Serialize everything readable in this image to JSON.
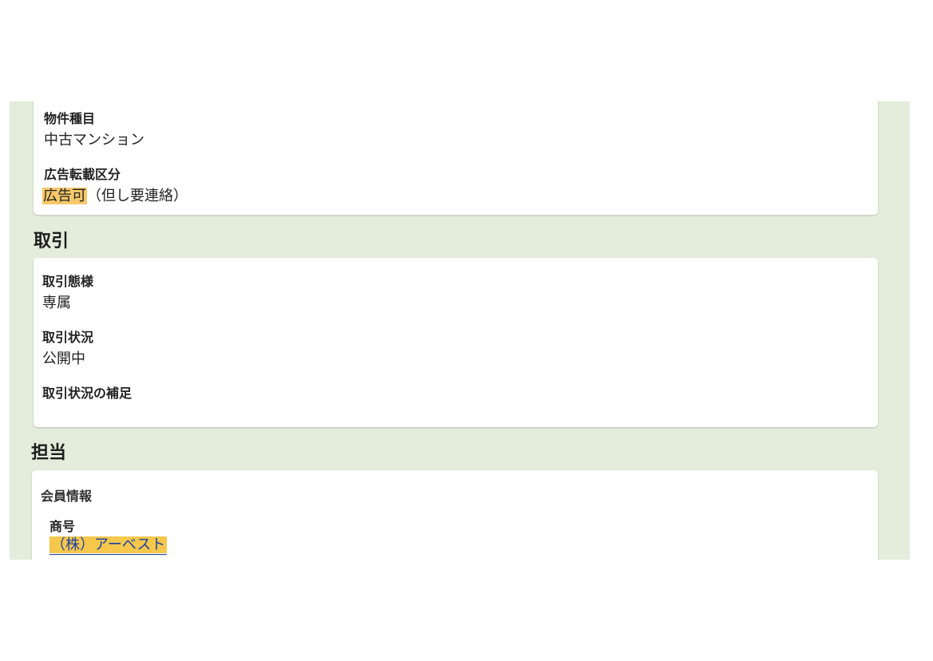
{
  "property_card": {
    "type_label": "物件種目",
    "type_value": "中古マンション",
    "ad_label": "広告転載区分",
    "ad_value_highlight": "広告可",
    "ad_value_rest": "（但し要連絡）"
  },
  "transaction": {
    "section_title": "取引",
    "mode_label": "取引態様",
    "mode_value": "専属",
    "status_label": "取引状況",
    "status_value": "公開中",
    "status_note_label": "取引状況の補足",
    "status_note_value": ""
  },
  "agent": {
    "section_title": "担当",
    "member_info_label": "会員情報",
    "trade_name_label": "商号",
    "trade_name_value": "（株）アーベスト"
  },
  "colors": {
    "page_background": "#e4ecdc",
    "card_background": "#ffffff",
    "highlight": "#f7c86a",
    "link": "#1a3fa8"
  }
}
